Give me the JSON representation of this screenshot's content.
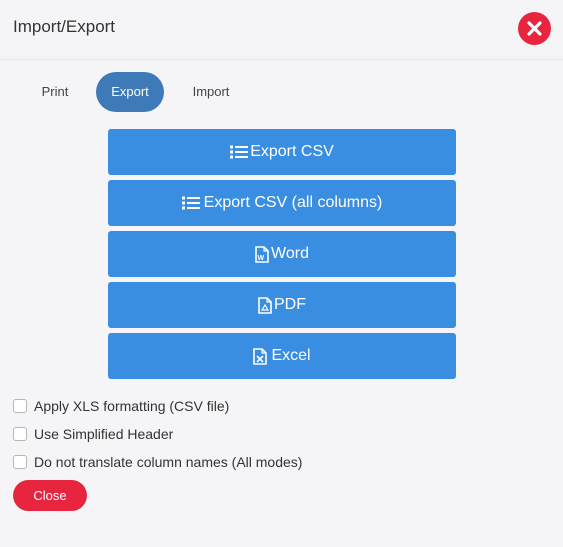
{
  "dialog": {
    "title": "Import/Export"
  },
  "tabs": [
    {
      "label": "Print",
      "active": false
    },
    {
      "label": "Export",
      "active": true
    },
    {
      "label": "Import",
      "active": false
    }
  ],
  "export_buttons": [
    {
      "label": "Export CSV",
      "icon": "list-icon"
    },
    {
      "label": "Export CSV (all columns)",
      "icon": "list-icon"
    },
    {
      "label": "Word",
      "icon": "word-file-icon"
    },
    {
      "label": "PDF",
      "icon": "pdf-file-icon"
    },
    {
      "label": "Excel",
      "icon": "excel-file-icon"
    }
  ],
  "options": [
    {
      "label": "Apply XLS formatting (CSV file)",
      "checked": false
    },
    {
      "label": "Use Simplified Header",
      "checked": false
    },
    {
      "label": "Do not translate column names (All modes)",
      "checked": false
    }
  ],
  "footer": {
    "close_label": "Close"
  },
  "colors": {
    "primary_button": "#3a8ee2",
    "active_tab": "#3e7ab8",
    "danger": "#e8253f",
    "background": "#f5f5f7"
  }
}
